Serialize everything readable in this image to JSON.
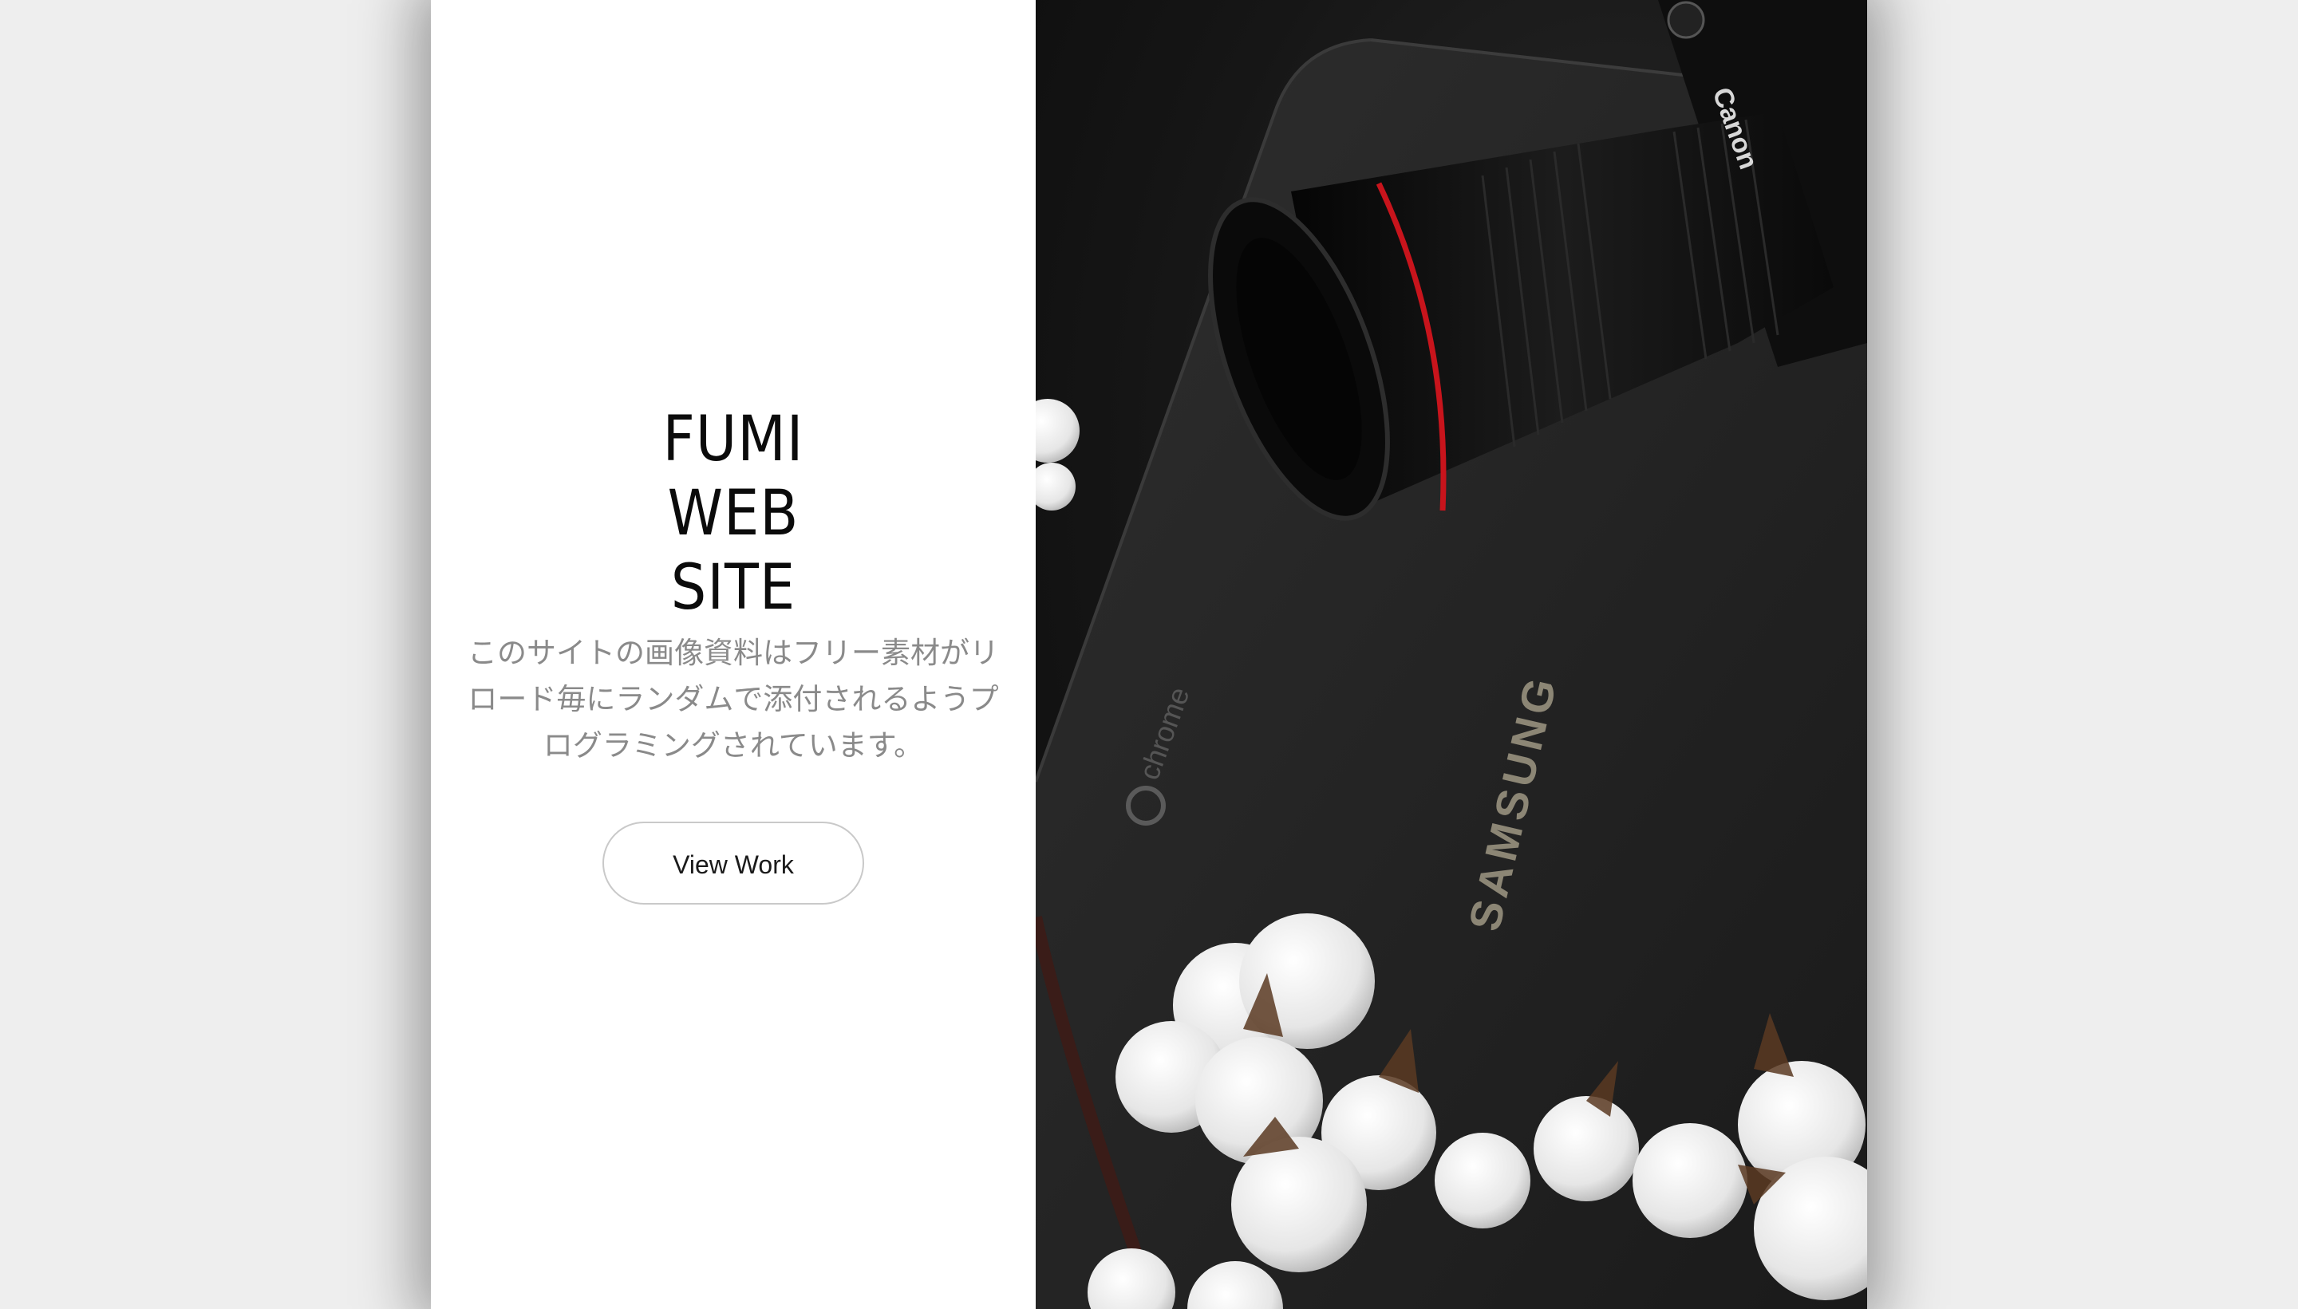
{
  "hero": {
    "title_lines": [
      "FUMI",
      "WEB",
      "SITE"
    ],
    "description": "このサイトの画像資料はフリー素材がリロード毎にランダムで添付されるようプログラミングされています。",
    "button_label": "View Work"
  },
  "photo": {
    "subject": "camera-and-laptop-photo",
    "laptop_brand_text": "SAMSUNG",
    "laptop_os_text": "chrome",
    "camera_brand_text": "Canon"
  },
  "colors": {
    "page_background": "#eeeeee",
    "panel_background": "#ffffff",
    "title_text": "#0b0b0b",
    "description_text": "#8a8a8a",
    "button_border": "#c9c9c9"
  }
}
